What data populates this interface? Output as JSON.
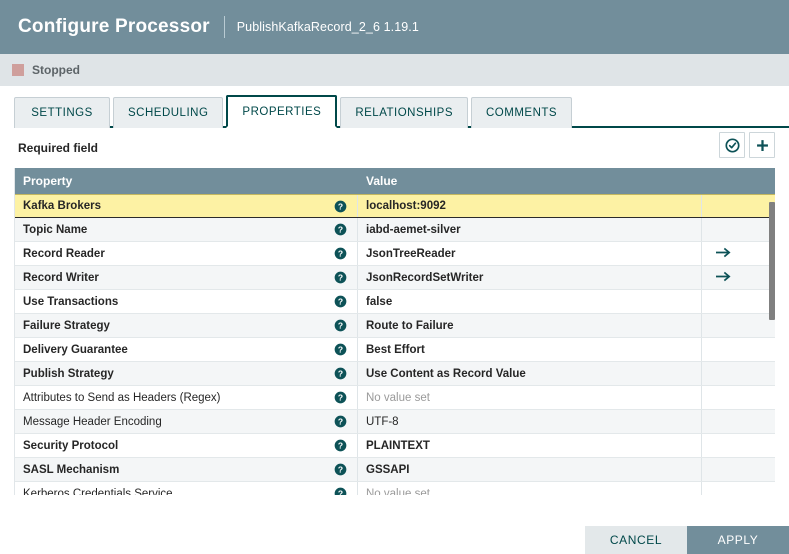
{
  "header": {
    "title": "Configure Processor",
    "subtitle": "PublishKafkaRecord_2_6 1.19.1"
  },
  "status": {
    "label": "Stopped",
    "color": "#cf9f9c"
  },
  "tabs": [
    {
      "label": "SETTINGS",
      "active": false
    },
    {
      "label": "SCHEDULING",
      "active": false
    },
    {
      "label": "PROPERTIES",
      "active": true
    },
    {
      "label": "RELATIONSHIPS",
      "active": false
    },
    {
      "label": "COMMENTS",
      "active": false
    }
  ],
  "toolbar": {
    "required_label": "Required field",
    "verify_icon": "check-circle-icon",
    "add_icon": "plus-icon"
  },
  "table": {
    "columns": {
      "property": "Property",
      "value": "Value"
    },
    "rows": [
      {
        "property": "Kafka Brokers",
        "value": "localhost:9092",
        "required": true,
        "selected": true,
        "has_goto": false,
        "empty": false
      },
      {
        "property": "Topic Name",
        "value": "iabd-aemet-silver",
        "required": true,
        "selected": false,
        "has_goto": false,
        "empty": false
      },
      {
        "property": "Record Reader",
        "value": "JsonTreeReader",
        "required": true,
        "selected": false,
        "has_goto": true,
        "empty": false
      },
      {
        "property": "Record Writer",
        "value": "JsonRecordSetWriter",
        "required": true,
        "selected": false,
        "has_goto": true,
        "empty": false
      },
      {
        "property": "Use Transactions",
        "value": "false",
        "required": true,
        "selected": false,
        "has_goto": false,
        "empty": false
      },
      {
        "property": "Failure Strategy",
        "value": "Route to Failure",
        "required": true,
        "selected": false,
        "has_goto": false,
        "empty": false
      },
      {
        "property": "Delivery Guarantee",
        "value": "Best Effort",
        "required": true,
        "selected": false,
        "has_goto": false,
        "empty": false
      },
      {
        "property": "Publish Strategy",
        "value": "Use Content as Record Value",
        "required": true,
        "selected": false,
        "has_goto": false,
        "empty": false
      },
      {
        "property": "Attributes to Send as Headers (Regex)",
        "value": "No value set",
        "required": false,
        "selected": false,
        "has_goto": false,
        "empty": true
      },
      {
        "property": "Message Header Encoding",
        "value": "UTF-8",
        "required": false,
        "selected": false,
        "has_goto": false,
        "empty": false
      },
      {
        "property": "Security Protocol",
        "value": "PLAINTEXT",
        "required": true,
        "selected": false,
        "has_goto": false,
        "empty": false
      },
      {
        "property": "SASL Mechanism",
        "value": "GSSAPI",
        "required": true,
        "selected": false,
        "has_goto": false,
        "empty": false
      },
      {
        "property": "Kerberos Credentials Service",
        "value": "No value set",
        "required": false,
        "selected": false,
        "has_goto": false,
        "empty": true
      }
    ]
  },
  "footer": {
    "cancel_label": "CANCEL",
    "apply_label": "APPLY"
  },
  "colors": {
    "header_bg": "#728e9b",
    "accent": "#004849",
    "selected_row": "#fdf2a4",
    "status": "#cf9f9c"
  }
}
